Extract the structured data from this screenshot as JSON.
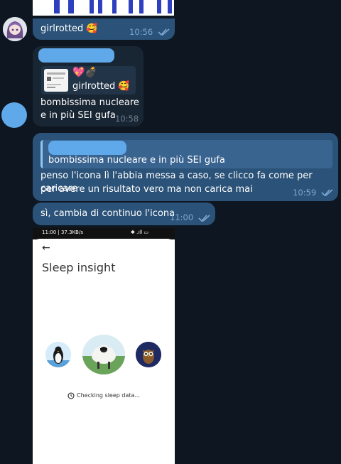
{
  "messages": {
    "m1": {
      "text": "girlrotted 🥰",
      "time": "10:56"
    },
    "m2": {
      "reply_emoji": "💖💣",
      "reply_text": "girlrotted 🥰",
      "line1": "bombissima nucleare",
      "line2": "e in più SEI gufa",
      "time": "10:58"
    },
    "m3": {
      "reply_text": "bombissima nucleare e in più SEI gufa",
      "line1": "penso l'icona lì l'abbia messa a caso, se clicco fa come per caricare",
      "line2": "per avere un risultato vero ma non carica mai",
      "time": "10:59"
    },
    "m4": {
      "text": "sì, cambia di continuo l'icona",
      "time": "11:00"
    }
  },
  "screenshot": {
    "status_left": "11:00 | 37.3KB/s",
    "status_right": "✱ .ıll ▭",
    "back_arrow": "←",
    "title": "Sleep insight",
    "loading_text": "Checking sleep data...",
    "icons": [
      "penguin-icon",
      "sheep-icon",
      "owl-icon"
    ]
  },
  "colors": {
    "background": "#0e1621",
    "incoming_bubble": "#182533",
    "outgoing_bubble": "#2b5278",
    "accent": "#64b5ef"
  }
}
